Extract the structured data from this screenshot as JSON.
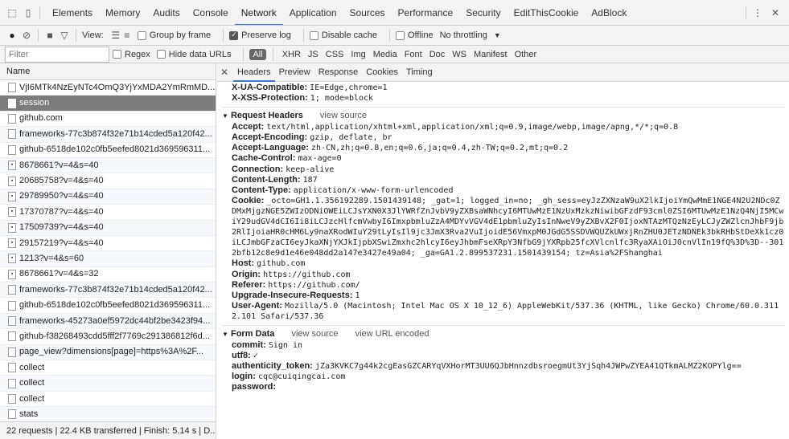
{
  "tabs": {
    "items": [
      "Elements",
      "Memory",
      "Audits",
      "Console",
      "Network",
      "Application",
      "Sources",
      "Performance",
      "Security",
      "EditThisCookie",
      "AdBlock"
    ],
    "active": "Network",
    "more_icon": "kebab-icon",
    "close_icon": "close-icon"
  },
  "toolbar": {
    "view_label": "View:",
    "group_by_frame": "Group by frame",
    "preserve_log": "Preserve log",
    "disable_cache": "Disable cache",
    "offline": "Offline",
    "throttling": "No throttling"
  },
  "filterbar": {
    "placeholder": "Filter",
    "regex": "Regex",
    "hide_data_urls": "Hide data URLs",
    "types": [
      "All",
      "XHR",
      "JS",
      "CSS",
      "Img",
      "Media",
      "Font",
      "Doc",
      "WS",
      "Manifest",
      "Other"
    ]
  },
  "requests": {
    "header": "Name",
    "items": [
      {
        "name": "VjI6MTk4NzEyNTc4OmQ3YjYxMDA2YmRmMD...",
        "icon": "file"
      },
      {
        "name": "session",
        "icon": "file",
        "selected": true
      },
      {
        "name": "github.com",
        "icon": "file"
      },
      {
        "name": "frameworks-77c3b874f32e71b14cded5a120f42...",
        "icon": "file"
      },
      {
        "name": "github-6518de102c0fb5eefed8021d369596311...",
        "icon": "file"
      },
      {
        "name": "8678661?v=4&s=40",
        "icon": "img"
      },
      {
        "name": "20685758?v=4&s=40",
        "icon": "img"
      },
      {
        "name": "29789950?v=4&s=40",
        "icon": "img"
      },
      {
        "name": "17370787?v=4&s=40",
        "icon": "img"
      },
      {
        "name": "17509739?v=4&s=40",
        "icon": "img"
      },
      {
        "name": "29157219?v=4&s=40",
        "icon": "img"
      },
      {
        "name": "1213?v=4&s=60",
        "icon": "img"
      },
      {
        "name": "8678661?v=4&s=32",
        "icon": "img"
      },
      {
        "name": "frameworks-77c3b874f32e71b14cded5a120f42...",
        "icon": "file"
      },
      {
        "name": "github-6518de102c0fb5eefed8021d369596311...",
        "icon": "file"
      },
      {
        "name": "frameworks-45273a0ef5972dc44bf2be3423f94...",
        "icon": "file"
      },
      {
        "name": "github-f38268493cdd5fff2f7769c291386812f6d...",
        "icon": "file"
      },
      {
        "name": "page_view?dimensions[page]=https%3A%2F...",
        "icon": "file"
      },
      {
        "name": "collect",
        "icon": "file"
      },
      {
        "name": "collect",
        "icon": "file"
      },
      {
        "name": "collect",
        "icon": "file"
      },
      {
        "name": "stats",
        "icon": "file"
      }
    ]
  },
  "status": "22 requests | 22.4 KB transferred | Finish: 5.14 s | D...",
  "detail": {
    "tabs": [
      "Headers",
      "Preview",
      "Response",
      "Cookies",
      "Timing"
    ],
    "active_tab": "Headers",
    "response_headers_tail": [
      {
        "k": "X-UA-Compatible:",
        "v": "IE=Edge,chrome=1"
      },
      {
        "k": "X-XSS-Protection:",
        "v": "1; mode=block"
      }
    ],
    "request_headers_title": "Request Headers",
    "view_source": "view source",
    "request_headers": [
      {
        "k": "Accept:",
        "v": "text/html,application/xhtml+xml,application/xml;q=0.9,image/webp,image/apng,*/*;q=0.8"
      },
      {
        "k": "Accept-Encoding:",
        "v": "gzip, deflate, br"
      },
      {
        "k": "Accept-Language:",
        "v": "zh-CN,zh;q=0.8,en;q=0.6,ja;q=0.4,zh-TW;q=0.2,mt;q=0.2"
      },
      {
        "k": "Cache-Control:",
        "v": "max-age=0"
      },
      {
        "k": "Connection:",
        "v": "keep-alive"
      },
      {
        "k": "Content-Length:",
        "v": "187"
      },
      {
        "k": "Content-Type:",
        "v": "application/x-www-form-urlencoded"
      },
      {
        "k": "Cookie:",
        "v": "_octo=GH1.1.356192289.1501439148; _gat=1; logged_in=no; _gh_sess=eyJzZXNzaW9uX2lkIjoiYmQwMmE1NGE4N2U2NDc0ZDMxMjgzNGE5ZWIzODNiOWEiLCJsYXN0X3JlYWRfZnJvbV9yZXBsaWNhcyI6MTUwMzE1NzUxMzkzNiwibGFzdF93cml0ZSI6MTUwMzE1NzQ4NjI5MCwiY29udGV4dCI6Ii8iLCJzcHlfcmVwbyI6ImxpbmluZzA4MDYvVGV4dE1pbmluZyIsInNweV9yZXBvX2F0IjoxNTAzMTQzNzEyLCJyZWZlcnJhbF9jb2RlIjoiaHR0cHM6Ly9naXRodWIuY29tLyIsIl9jc3JmX3Rva2VuIjoidE56VmxpM0JGdG5SSDVWQUZkUWxjRnZHU0JETzNDNEk3bkRHbStDeXk1cz0iLCJmbGFzaCI6eyJkaXNjYXJkIjpbXSwiZmxhc2hlcyI6eyJhbmFseXRpY3NfbG9jYXRpb25fcXVlcnlfc3RyaXAiOiJ0cnVlIn19fQ%3D%3D--3012bfb12c8e9d1e46e048dd2a147e3427e49a04; _ga=GA1.2.899537231.1501439154; tz=Asia%2FShanghai"
      },
      {
        "k": "Host:",
        "v": "github.com"
      },
      {
        "k": "Origin:",
        "v": "https://github.com"
      },
      {
        "k": "Referer:",
        "v": "https://github.com/"
      },
      {
        "k": "Upgrade-Insecure-Requests:",
        "v": "1"
      },
      {
        "k": "User-Agent:",
        "v": "Mozilla/5.0 (Macintosh; Intel Mac OS X 10_12_6) AppleWebKit/537.36 (KHTML, like Gecko) Chrome/60.0.3112.101 Safari/537.36"
      }
    ],
    "form_data_title": "Form Data",
    "view_url_encoded": "view URL encoded",
    "form_data": [
      {
        "k": "commit:",
        "v": "Sign in"
      },
      {
        "k": "utf8:",
        "v": "✓"
      },
      {
        "k": "authenticity_token:",
        "v": "jZa3KVKC7g44k2cgEasGZCARYqVXHorMT3UU6QJbHnnzdbsroegmUt3YjSqh4JWPwZYEA41QTkmALMZ2KOPYlg=="
      },
      {
        "k": "login:",
        "v": "cqc@cuiqingcai.com"
      },
      {
        "k": "password:",
        "v": ""
      }
    ]
  }
}
